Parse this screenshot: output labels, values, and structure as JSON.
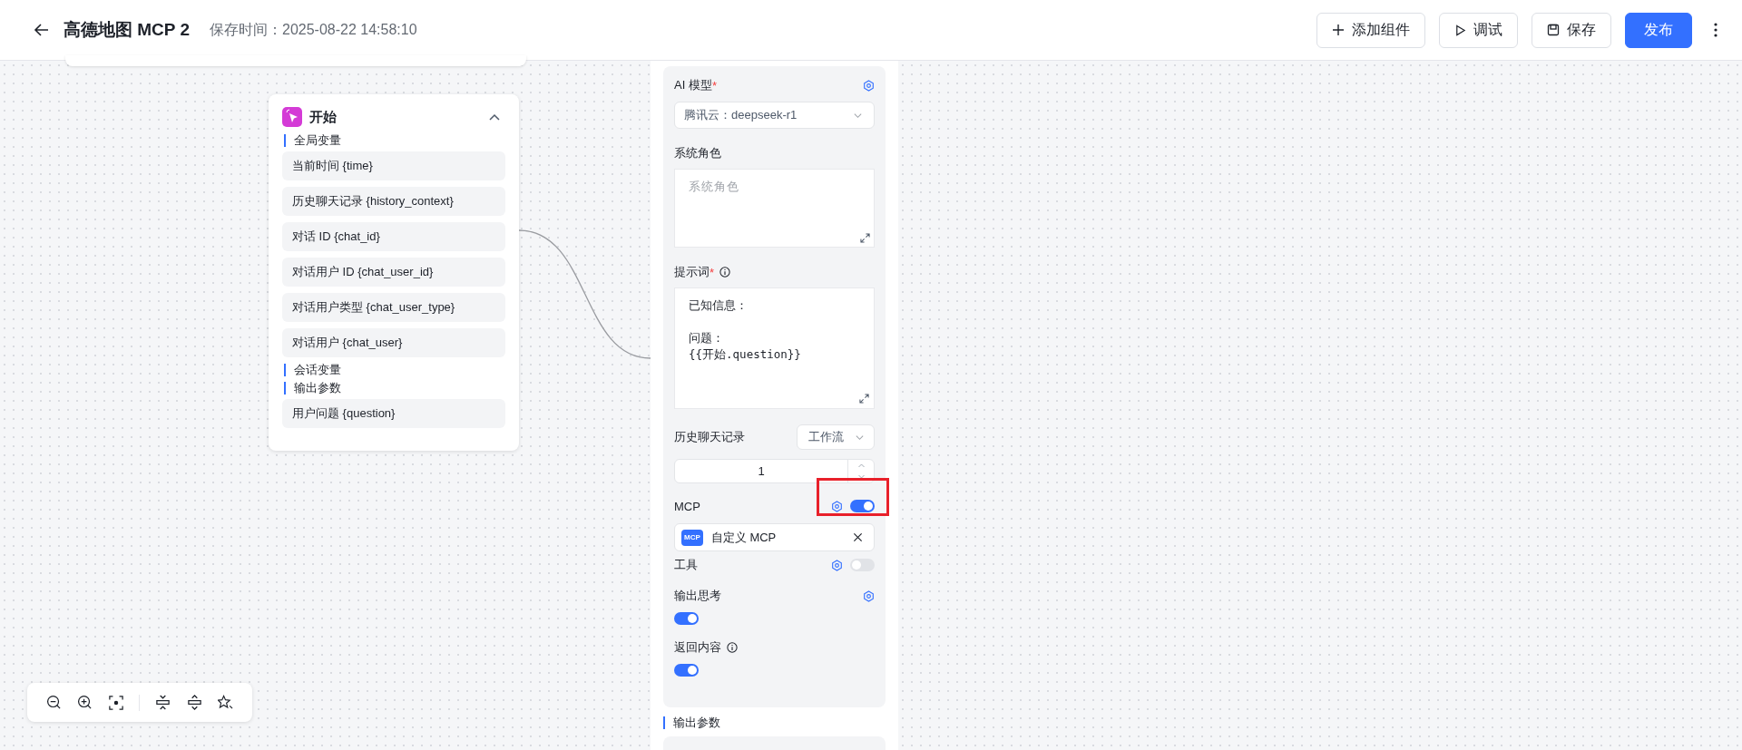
{
  "header": {
    "title": "高德地图 MCP 2",
    "save_time": "保存时间：2025-08-22 14:58:10",
    "buttons": [
      {
        "label": "添加组件",
        "kind": "add"
      },
      {
        "label": "调试",
        "kind": "debug"
      },
      {
        "label": "保存",
        "kind": "save"
      },
      {
        "label": "发布",
        "kind": "publish"
      }
    ]
  },
  "start_node": {
    "title": "开始",
    "expanded": true,
    "sections": [
      {
        "title": "全局变量",
        "items": [
          "当前时间 {time}",
          "历史聊天记录 {history_context}",
          "对话 ID {chat_id}",
          "对话用户 ID {chat_user_id}",
          "对话用户类型 {chat_user_type}",
          "对话用户 {chat_user}"
        ]
      },
      {
        "title": "会话变量"
      },
      {
        "title": "输出参数",
        "items": [
          "用户问题 {question}"
        ]
      }
    ]
  },
  "ai_node": {
    "model": {
      "label": "AI 模型",
      "required_mark": "*",
      "value": "腾讯云：deepseek-r1"
    },
    "system_role": {
      "label": "系统角色",
      "placeholder": "系统角色"
    },
    "prompt": {
      "label": "提示词",
      "required_mark": "*",
      "paragraphs": [
        [
          "已知信息："
        ],
        [
          "问题：",
          "{{开始.question}}"
        ]
      ]
    },
    "history": {
      "label": "历史聊天记录",
      "mode": "工作流",
      "count": "1"
    },
    "mcp": {
      "label": "MCP",
      "on": true,
      "item": "自定义 MCP",
      "item_icon": "MCP"
    },
    "tools": {
      "label": "工具",
      "on": false
    },
    "output_thinking": {
      "label": "输出思考",
      "on": true
    },
    "return_content": {
      "label": "返回内容",
      "on": true
    },
    "output_section": "输出参数"
  }
}
